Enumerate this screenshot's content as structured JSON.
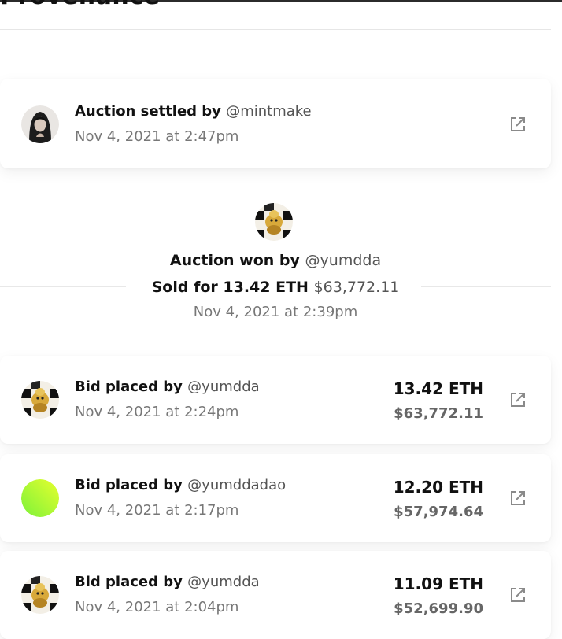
{
  "section_title": "Provenance",
  "events": [
    {
      "action": "Auction settled by",
      "handle": "@mintmake",
      "timestamp": "Nov 4, 2021 at 2:47pm"
    }
  ],
  "auction_won": {
    "action": "Auction won by",
    "handle": "@yumdda",
    "sold_prefix": "Sold for",
    "eth": "13.42 ETH",
    "usd": "$63,772.11",
    "timestamp": "Nov 4, 2021 at 2:39pm"
  },
  "bids": [
    {
      "action": "Bid placed by",
      "handle": "@yumdda",
      "timestamp": "Nov 4, 2021 at 2:24pm",
      "eth": "13.42 ETH",
      "usd": "$63,772.11"
    },
    {
      "action": "Bid placed by",
      "handle": "@yumddadao",
      "timestamp": "Nov 4, 2021 at 2:17pm",
      "eth": "12.20 ETH",
      "usd": "$57,974.64"
    },
    {
      "action": "Bid placed by",
      "handle": "@yumdda",
      "timestamp": "Nov 4, 2021 at 2:04pm",
      "eth": "11.09 ETH",
      "usd": "$52,699.90"
    }
  ],
  "icons": {
    "external_link": "external-link-icon"
  }
}
